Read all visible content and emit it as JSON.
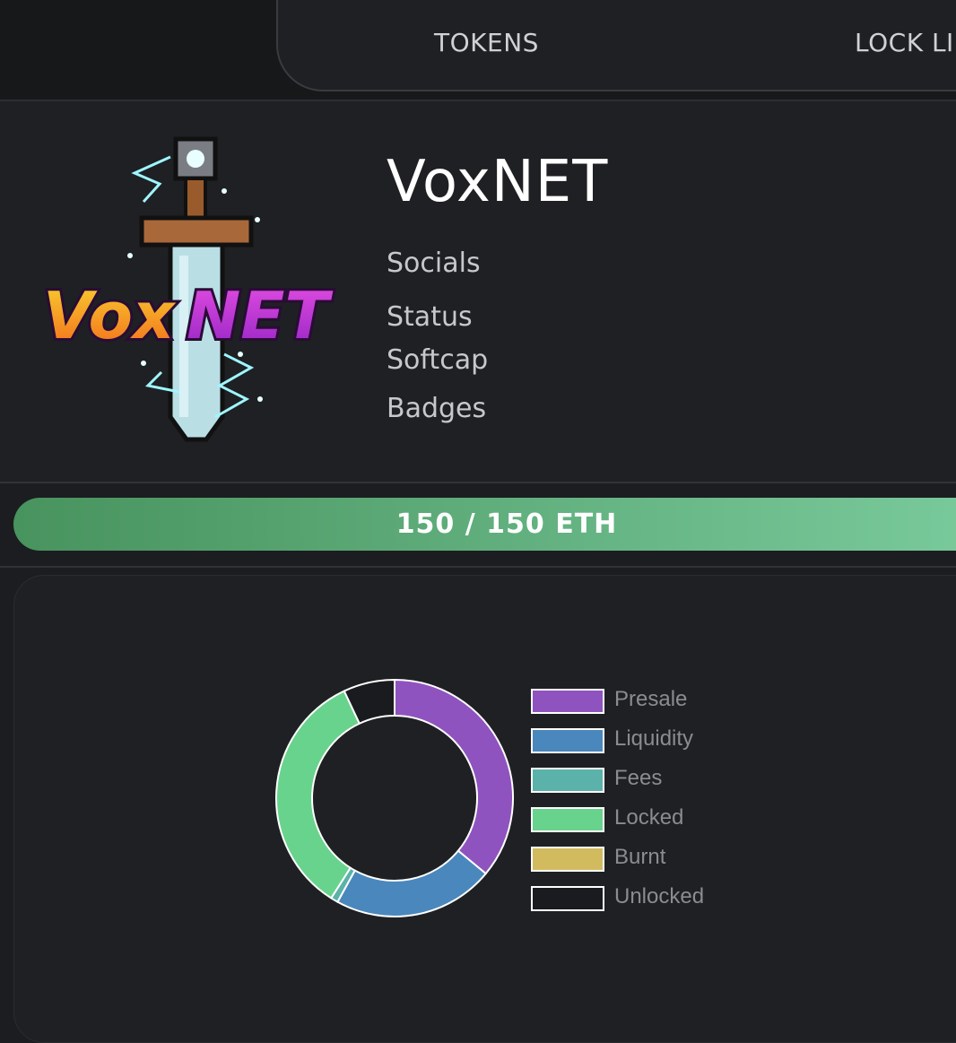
{
  "nav": {
    "tabs": [
      "TOKENS",
      "LOCK LI"
    ]
  },
  "token": {
    "name": "VoxNET",
    "logo_text": "VoxNET",
    "fields": [
      "Socials",
      "Status",
      "Softcap",
      "Badges"
    ]
  },
  "progress": {
    "label": "150 / 150 ETH",
    "fraction": 1.0
  },
  "colors": {
    "presale": "#8f53bf",
    "liquidity": "#4a87bd",
    "fees": "#5ab2aa",
    "locked": "#68d38c",
    "burnt": "#d2bb5f",
    "unlocked": "#1a1b1e"
  },
  "chart_data": {
    "type": "pie",
    "variant": "doughnut",
    "legend_position": "right",
    "labels": [
      "Presale",
      "Liquidity",
      "Fees",
      "Locked",
      "Burnt",
      "Unlocked"
    ],
    "values": [
      36,
      22,
      1,
      34,
      0,
      7
    ],
    "colors": [
      "#8f53bf",
      "#4a87bd",
      "#5ab2aa",
      "#68d38c",
      "#d2bb5f",
      "#1a1b1e"
    ]
  }
}
